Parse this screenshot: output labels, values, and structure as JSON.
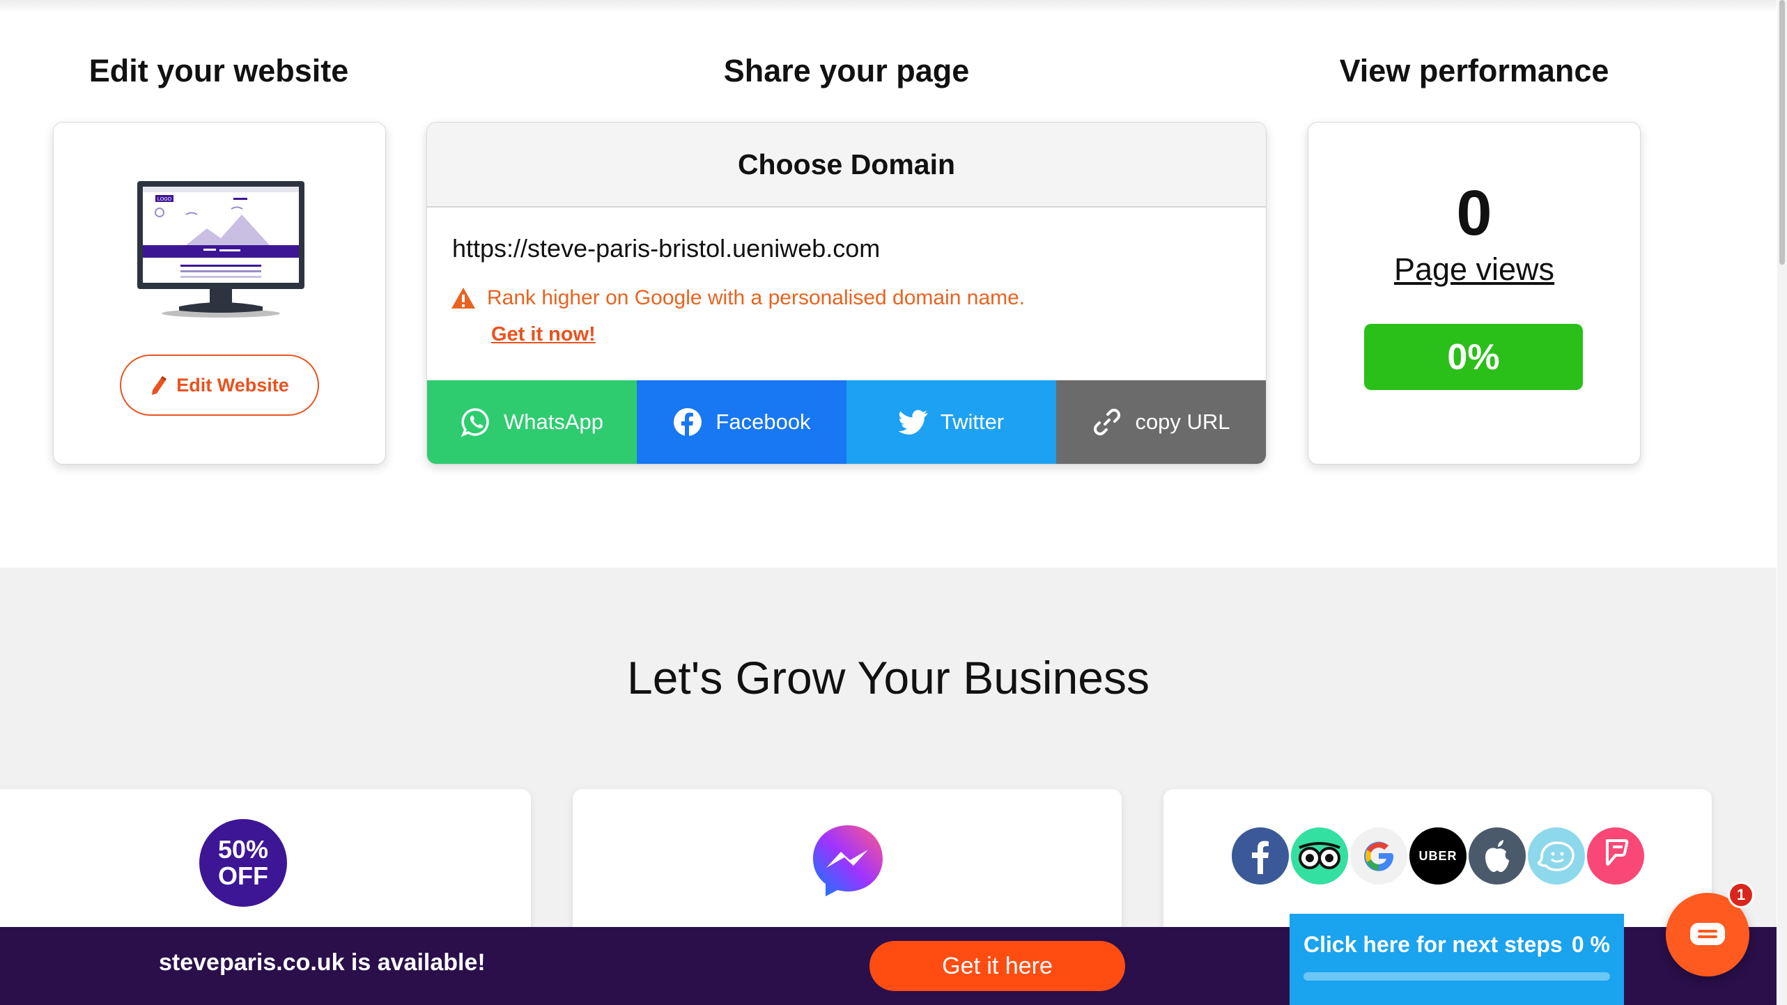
{
  "sections": {
    "edit_title": "Edit your website",
    "share_title": "Share your page",
    "performance_title": "View performance"
  },
  "edit_card": {
    "button_label": "Edit Website",
    "preview_logo_text": "LOGO",
    "icon": "pencil-icon"
  },
  "domain_card": {
    "header": "Choose Domain",
    "url": "https://steve-paris-bristol.ueniweb.com",
    "warning": "Rank higher on Google with a personalised domain name.",
    "cta": "Get it now!",
    "share_buttons": [
      {
        "label": "WhatsApp",
        "icon": "whatsapp-icon",
        "color": "#2ecc6f"
      },
      {
        "label": "Facebook",
        "icon": "facebook-icon",
        "color": "#1877f2"
      },
      {
        "label": "Twitter",
        "icon": "twitter-icon",
        "color": "#1da1f2"
      },
      {
        "label": "copy URL",
        "icon": "link-icon",
        "color": "#6b6b6b"
      }
    ]
  },
  "performance_card": {
    "count": "0",
    "label": "Page views",
    "percent": "0%"
  },
  "grow": {
    "title": "Let's Grow Your Business",
    "offer_line1": "50%",
    "offer_line2": "OFF",
    "uber_label": "UBER"
  },
  "banner": {
    "text": "steveparis.co.uk is available!",
    "button": "Get it here"
  },
  "next_steps": {
    "label": "Click here for next steps",
    "percent": "0 %",
    "progress": 0
  },
  "chat": {
    "badge": "1"
  },
  "colors": {
    "accent_orange": "#e8531f",
    "success_green": "#2bbf19",
    "banner_purple": "#2a0f4a",
    "next_steps_blue": "#1aa3ef"
  }
}
